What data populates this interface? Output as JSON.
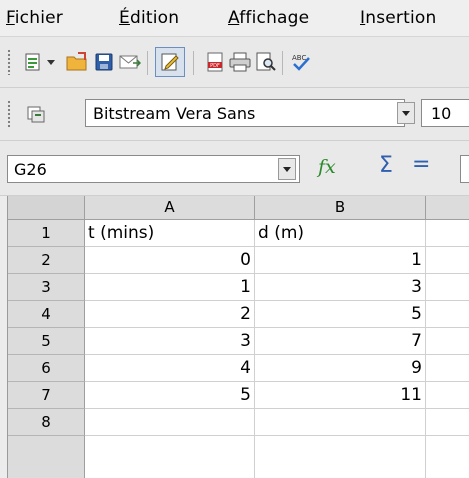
{
  "menubar": {
    "items": [
      {
        "label": "Fichier",
        "mnemonic": "F",
        "rest": "ichier"
      },
      {
        "label": "Édition",
        "mnemonic": "É",
        "rest": "dition"
      },
      {
        "label": "Affichage",
        "mnemonic": "A",
        "rest": "ffichage"
      },
      {
        "label": "Insertion",
        "mnemonic": "I",
        "rest": "nsertion"
      }
    ]
  },
  "formatting": {
    "font_name": "Bitstream Vera Sans",
    "font_size": "10"
  },
  "formula_bar": {
    "cell_reference": "G26",
    "function_wizard_label": "fx",
    "sum_symbol": "Σ",
    "equals_symbol": "="
  },
  "sheet": {
    "columns": [
      "A",
      "B"
    ],
    "rows": [
      {
        "n": "1",
        "a": "t (mins)",
        "b": "d (m)"
      },
      {
        "n": "2",
        "a": "0",
        "b": "1"
      },
      {
        "n": "3",
        "a": "1",
        "b": "3"
      },
      {
        "n": "4",
        "a": "2",
        "b": "5"
      },
      {
        "n": "5",
        "a": "3",
        "b": "7"
      },
      {
        "n": "6",
        "a": "4",
        "b": "9"
      },
      {
        "n": "7",
        "a": "5",
        "b": "11"
      },
      {
        "n": "8",
        "a": "",
        "b": ""
      }
    ]
  },
  "icons": {
    "toolbar": [
      "new-document-icon",
      "dropdown-arrow-icon",
      "open-folder-icon",
      "save-icon",
      "email-icon",
      "edit-mode-icon",
      "export-pdf-icon",
      "print-icon",
      "page-preview-icon",
      "spellcheck-icon"
    ],
    "formatting": [
      "styles-icon",
      "chevron-down-icon"
    ]
  },
  "colors": {
    "window_bg": "#ececec",
    "header_bg": "#dcdcdc",
    "active_toggle_border": "#6b8fbf"
  }
}
